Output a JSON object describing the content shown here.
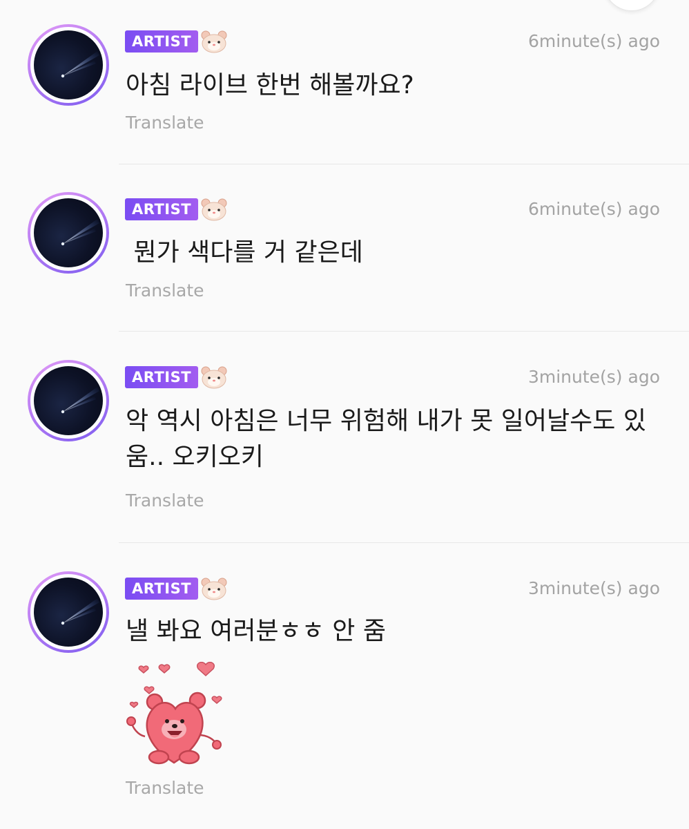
{
  "comments": [
    {
      "badge": "ARTIST",
      "time": "6minute(s) ago",
      "text": "아침 라이브 한번 해볼까요?",
      "translate": "Translate"
    },
    {
      "badge": "ARTIST",
      "time": "6minute(s) ago",
      "text": " 뭔가 색다를 거 같은데",
      "translate": "Translate"
    },
    {
      "badge": "ARTIST",
      "time": "3minute(s) ago",
      "text": "악 역시 아침은 너무 위험해 내가 못 일어날수도 있움.. 오키오키",
      "translate": "Translate"
    },
    {
      "badge": "ARTIST",
      "time": "3minute(s) ago",
      "text": "낼 봐요 여러분ㅎㅎ 안 줌",
      "translate": "Translate",
      "sticker": "pink-bear-hearts-sticker"
    }
  ],
  "icons": {
    "avatar": "comet-night-sky-avatar",
    "badge_emoji": "hamster-face-icon"
  },
  "colors": {
    "badge_start": "#7a4df2",
    "badge_end": "#a25cf0",
    "avatar_ring": "#b67cf3",
    "muted_text": "#a3a3a3",
    "background": "#fafafa"
  }
}
